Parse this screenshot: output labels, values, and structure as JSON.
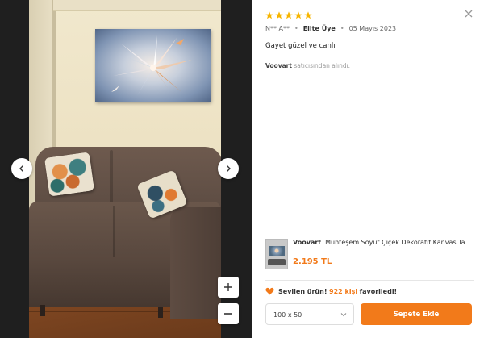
{
  "media": {
    "prev_icon": "chevron-left-icon",
    "next_icon": "chevron-right-icon",
    "zoom_in_icon": "plus-icon",
    "zoom_out_icon": "minus-icon"
  },
  "review": {
    "rating": 5,
    "rating_max": 5,
    "star_color": "#f7b500",
    "author": "N** A**",
    "badge": "Elite Üye",
    "date": "05 Mayıs 2023",
    "comment": "Gayet güzel ve canlı",
    "seller_name": "Voovart",
    "seller_suffix": "satıcısından alındı."
  },
  "product": {
    "brand": "Voovart",
    "title": "Muhteşem Soyut Çiçek Dekoratif Kanvas Tablo...",
    "price": "2.195 TL"
  },
  "favorite": {
    "icon": "heart-icon",
    "prefix": "Sevilen ürün!",
    "count": "922 kişi",
    "suffix": "favoriledi!"
  },
  "controls": {
    "size_value": "100 x 50",
    "add_to_cart": "Sepete Ekle",
    "close_icon": "close-icon"
  },
  "colors": {
    "accent": "#f27a1a",
    "star": "#f7b500"
  }
}
